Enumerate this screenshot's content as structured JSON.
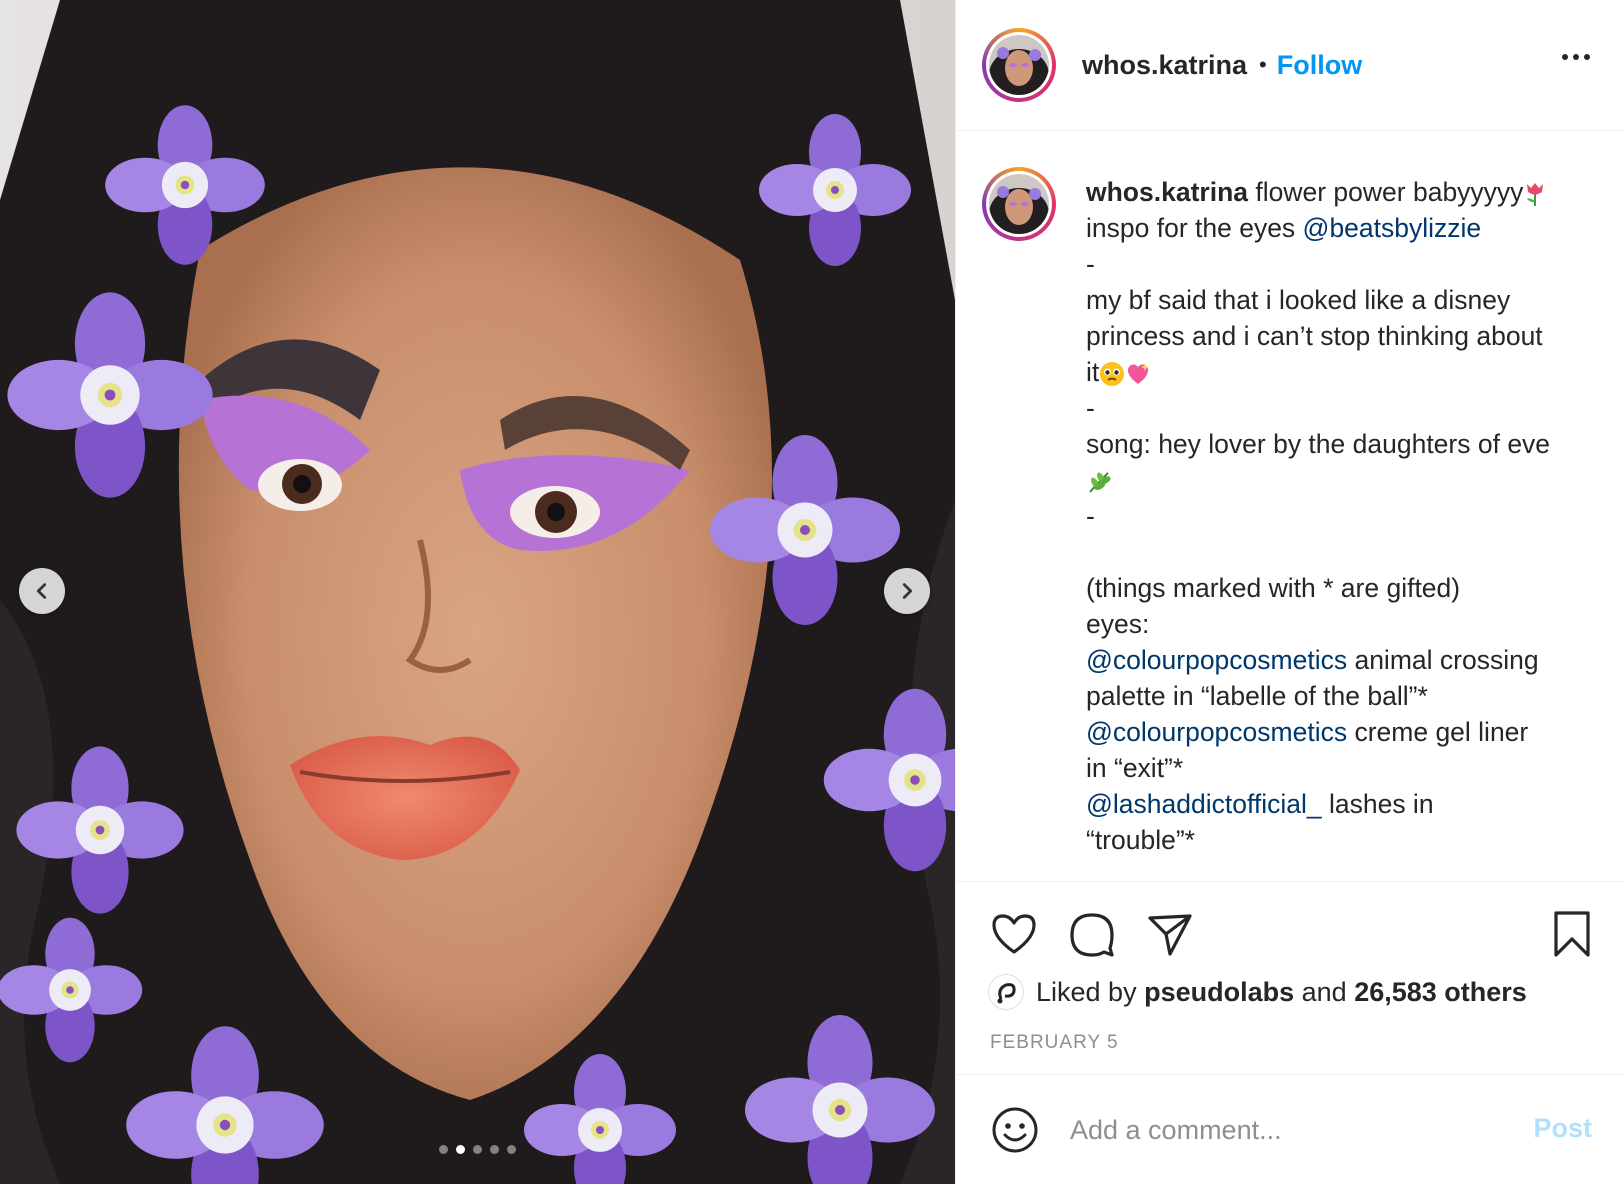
{
  "header": {
    "username": "whos.katrina",
    "separator": "•",
    "follow_label": "Follow",
    "more_icon": "more-horizontal-icon"
  },
  "caption": {
    "username": "whos.katrina",
    "line1": "flower power babyyyyy",
    "line2_pre": "inspo for the eyes ",
    "line2_mention": "@beatsbylizzie",
    "dash1": "-",
    "line3": "my bf said that i looked like a disney",
    "line4": "princess and i can’t stop thinking about",
    "line5": "it",
    "dash2": "-",
    "line6": "song: hey lover by the daughters of eve",
    "dash3": "-",
    "line7": "(things marked with * are gifted)",
    "line8": "eyes:",
    "line9_mention": "@colourpopcosmetics",
    "line9_rest": " animal crossing",
    "line10": "palette in “labelle of the ball”*",
    "line11_mention": "@colourpopcosmetics",
    "line11_rest": " creme gel liner",
    "line12": "in “exit”*",
    "line13_mention": "@lashaddictofficial_",
    "line13_rest": " lashes in",
    "line14": "“trouble”*"
  },
  "likes": {
    "prefix": "Liked by ",
    "user": "pseudolabs",
    "middle": " and ",
    "count": "26,583 others"
  },
  "date": "FEBRUARY 5",
  "comment": {
    "placeholder": "Add a comment...",
    "post_label": "Post"
  },
  "carousel": {
    "slides": 5,
    "current": 2
  },
  "colors": {
    "accent": "#0095f6",
    "mention": "#00376b",
    "text": "#262626",
    "muted": "#8e8e8e",
    "post_disabled": "#b2dffc"
  }
}
